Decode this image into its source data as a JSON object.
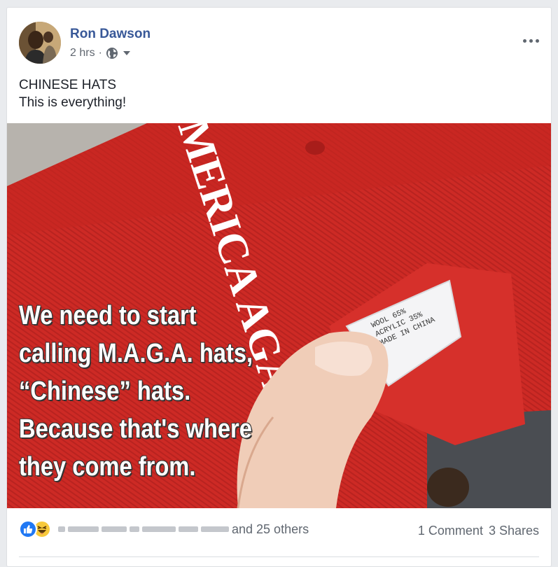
{
  "post": {
    "author": "Ron Dawson",
    "time": "2 hrs",
    "separator": "·",
    "privacy_icon": "globe-icon",
    "text_lines": [
      "CHINESE HATS",
      "This is everything!"
    ]
  },
  "photo": {
    "hat_embroidery": "MERICA AGAIN",
    "tag_lines": [
      "WOOL 65%",
      "ACRYLIC 35%",
      "MADE IN CHINA"
    ],
    "meme_lines": [
      "We need to start",
      "calling M.A.G.A. hats,",
      "“Chinese” hats.",
      "Because that's where",
      "they come from."
    ]
  },
  "footer": {
    "others": "and 25 others",
    "comments": "1 Comment",
    "shares": "3 Shares",
    "reaction_icons": [
      "like-icon",
      "haha-icon"
    ]
  },
  "colors": {
    "link": "#385898",
    "like": "#2078f4",
    "haha": "#f7c93c",
    "hat_red": "#c92723"
  }
}
